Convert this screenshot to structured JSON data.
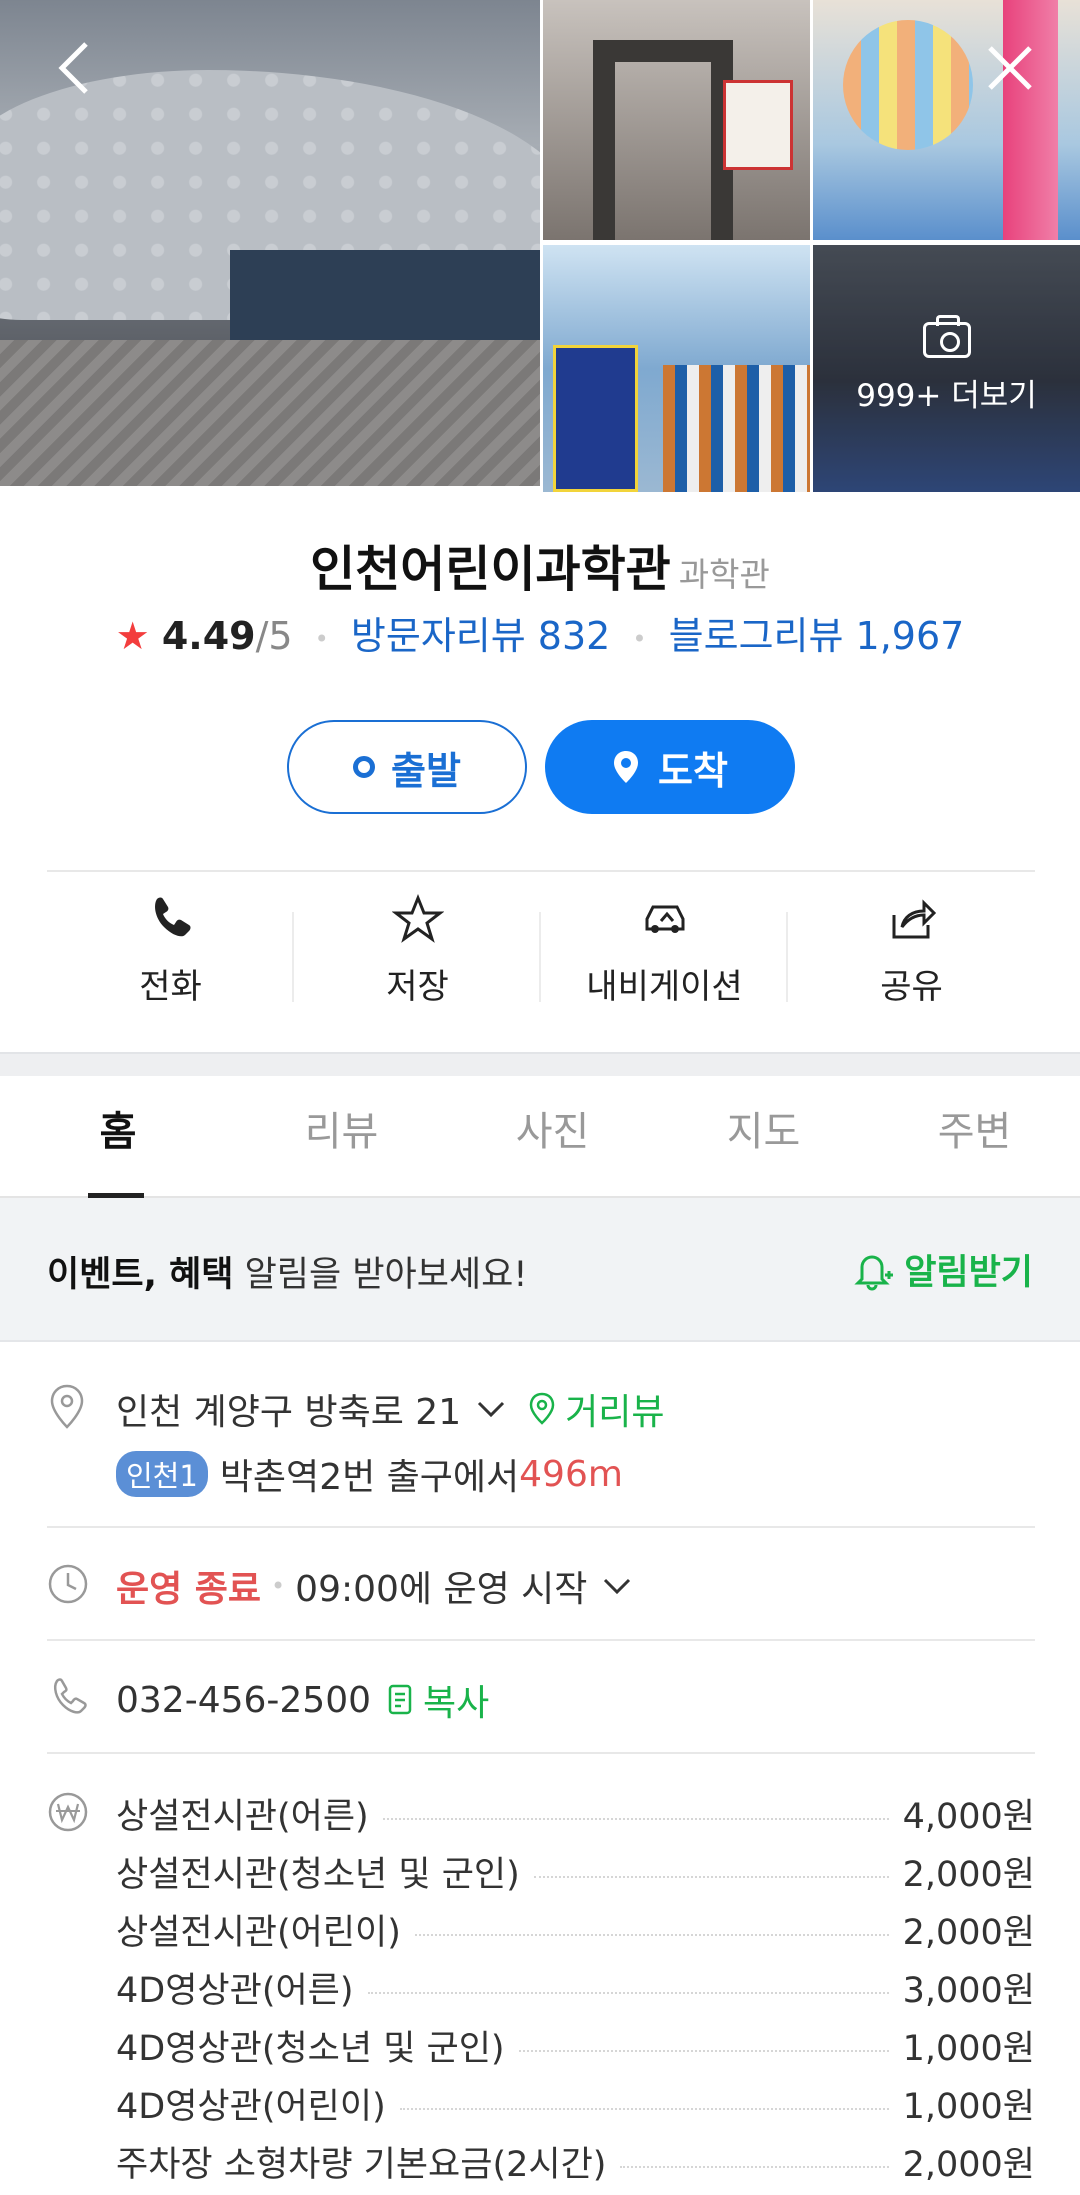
{
  "gallery": {
    "more_label": "999+ 더보기"
  },
  "place": {
    "name": "인천어린이과학관",
    "category": "과학관",
    "rating": "4.49",
    "rating_max": "/5",
    "visitor_review": "방문자리뷰 832",
    "blog_review": "블로그리뷰 1,967"
  },
  "route": {
    "depart_label": "출발",
    "arrive_label": "도착"
  },
  "actions": [
    {
      "label": "전화",
      "icon": "phone-icon"
    },
    {
      "label": "저장",
      "icon": "star-icon"
    },
    {
      "label": "내비게이션",
      "icon": "car-icon"
    },
    {
      "label": "공유",
      "icon": "share-icon"
    }
  ],
  "tabs": [
    "홈",
    "리뷰",
    "사진",
    "지도",
    "주변"
  ],
  "notice": {
    "bold": "이벤트, 혜택",
    "text": " 알림을 받아보세요!",
    "button": "알림받기"
  },
  "info": {
    "address": "인천 계양구 방축로 21",
    "street_view": "거리뷰",
    "subway_line": "인천1",
    "station": "박촌역",
    "exit_text": " 2번 출구에서 ",
    "distance": "496m",
    "status": "운영 종료",
    "hours": "09:00에 운영 시작",
    "phone": "032-456-2500",
    "copy_label": "복사"
  },
  "prices": [
    {
      "name": "상설전시관(어른)",
      "price": "4,000원"
    },
    {
      "name": "상설전시관(청소년 및 군인)",
      "price": "2,000원"
    },
    {
      "name": "상설전시관(어린이)",
      "price": "2,000원"
    },
    {
      "name": "4D영상관(어른)",
      "price": "3,000원"
    },
    {
      "name": "4D영상관(청소년 및 군인)",
      "price": "1,000원"
    },
    {
      "name": "4D영상관(어린이)",
      "price": "1,000원"
    },
    {
      "name": "주차장 소형차량 기본요금(2시간)",
      "price": "2,000원"
    }
  ],
  "colors": {
    "accent_blue": "#0f7bf2",
    "link_blue": "#1a66c7",
    "green": "#19b34a",
    "red": "#e25353",
    "star_red": "#f33d3d"
  }
}
